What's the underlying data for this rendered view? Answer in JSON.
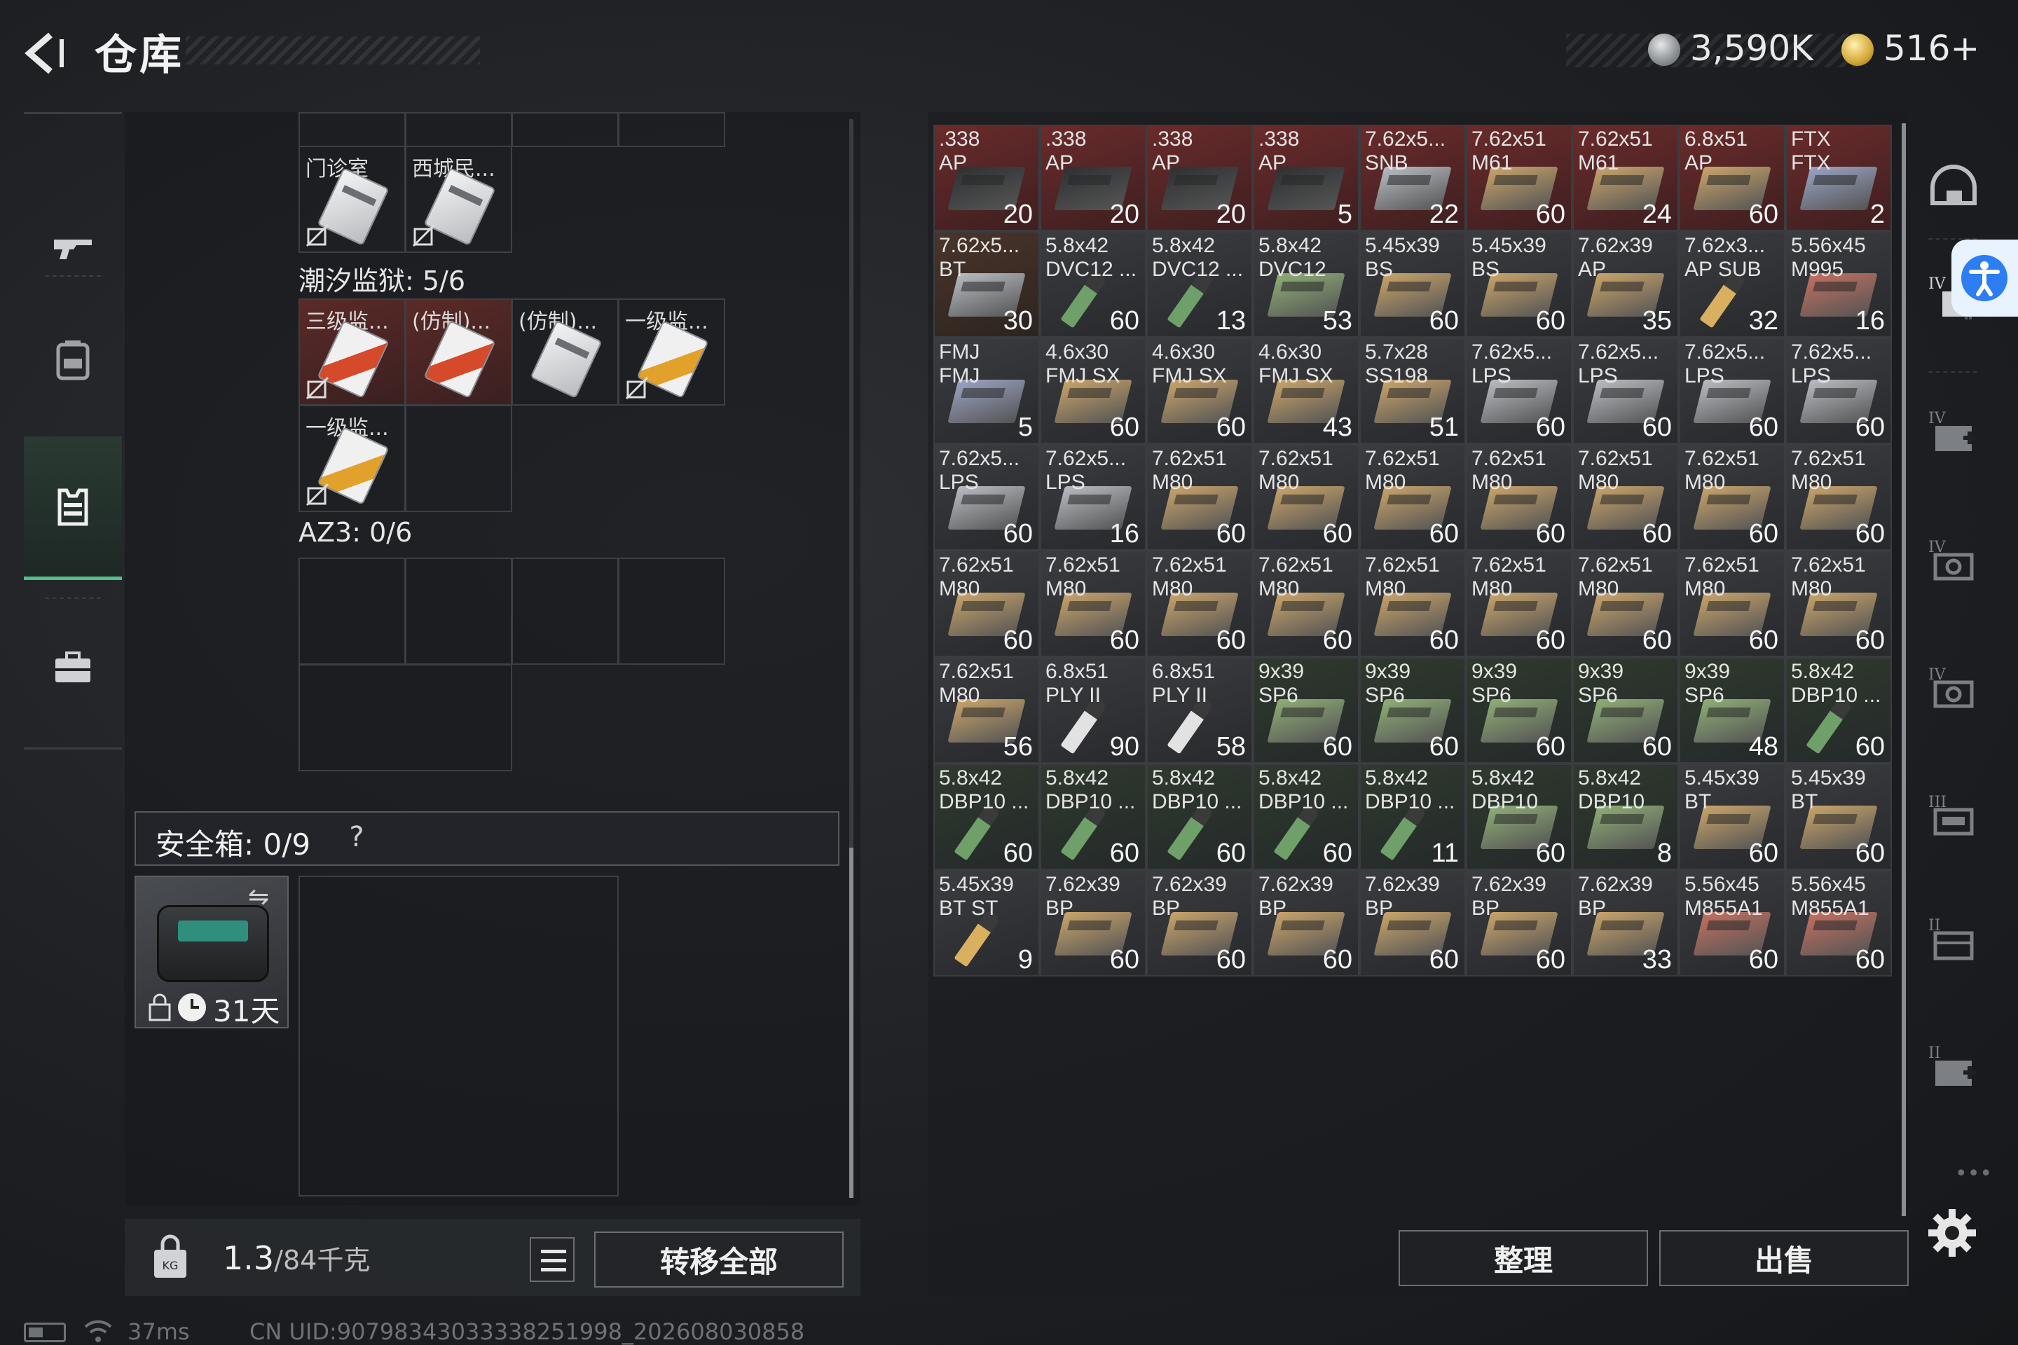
{
  "header": {
    "title": "仓库",
    "currency_silver": "3,590K",
    "currency_gold": "516+"
  },
  "left_nav": {
    "items": [
      "weapon-icon",
      "backpack-icon",
      "vest-icon",
      "case-icon"
    ],
    "active_index": 2
  },
  "containers": {
    "keys_top_row": [
      "门诊室",
      "西城民..."
    ],
    "section1_label": "潮汐监狱: 5/6",
    "section1_items": [
      "三级监...",
      "(仿制)...",
      "(仿制)...",
      "一级监...",
      "一级监..."
    ],
    "section2_label": "AZ3: 0/6"
  },
  "safe_box": {
    "label": "安全箱:  0/9",
    "help": "?",
    "duration": "31天"
  },
  "bottom_left": {
    "weight_main": "1.3",
    "weight_rest": "/84千克",
    "transfer_all": "转移全部"
  },
  "inventory": {
    "colors": {
      "red_slot": "#5c2627",
      "default_slot": "#34363a",
      "green_slot": "#2e3b2c",
      "ammo_box_tan": "#c9a46a",
      "ammo_box_grey": "#b8bcc2",
      "ammo_box_green": "#8fae76"
    },
    "rows": [
      [
        {
          "l1": ".338",
          "l2": "AP",
          "count": "20",
          "bg": "red",
          "icon": "box-dark"
        },
        {
          "l1": ".338",
          "l2": "AP",
          "count": "20",
          "bg": "red",
          "icon": "box-dark"
        },
        {
          "l1": ".338",
          "l2": "AP",
          "count": "20",
          "bg": "red",
          "icon": "box-dark"
        },
        {
          "l1": ".338",
          "l2": "AP",
          "count": "5",
          "bg": "red",
          "icon": "box-dark"
        },
        {
          "l1": "7.62x5...",
          "l2": "SNB",
          "count": "22",
          "bg": "red",
          "icon": "box-grey"
        },
        {
          "l1": "7.62x51",
          "l2": "M61",
          "count": "60",
          "bg": "red",
          "icon": "box-tan"
        },
        {
          "l1": "7.62x51",
          "l2": "M61",
          "count": "24",
          "bg": "red",
          "icon": "box-tan"
        },
        {
          "l1": "6.8x51",
          "l2": "AP",
          "count": "60",
          "bg": "red",
          "icon": "box-tan"
        },
        {
          "l1": "FTX",
          "l2": "FTX",
          "count": "2",
          "bg": "red",
          "icon": "box-blue"
        }
      ],
      [
        {
          "l1": "7.62x5...",
          "l2": "BT",
          "count": "30",
          "bg": "brown",
          "icon": "box-grey"
        },
        {
          "l1": "5.8x42",
          "l2": "DVC12 ...",
          "count": "60",
          "bg": "default",
          "icon": "round-green"
        },
        {
          "l1": "5.8x42",
          "l2": "DVC12 ...",
          "count": "13",
          "bg": "default",
          "icon": "round-green"
        },
        {
          "l1": "5.8x42",
          "l2": "DVC12",
          "count": "53",
          "bg": "default",
          "icon": "box-green"
        },
        {
          "l1": "5.45x39",
          "l2": "BS",
          "count": "60",
          "bg": "default",
          "icon": "box-tan"
        },
        {
          "l1": "5.45x39",
          "l2": "BS",
          "count": "60",
          "bg": "default",
          "icon": "box-tan"
        },
        {
          "l1": "7.62x39",
          "l2": "AP",
          "count": "35",
          "bg": "default",
          "icon": "box-tan"
        },
        {
          "l1": "7.62x3...",
          "l2": "AP SUB",
          "count": "32",
          "bg": "default",
          "icon": "round-brass"
        },
        {
          "l1": "5.56x45",
          "l2": "M995",
          "count": "16",
          "bg": "default",
          "icon": "box-red"
        }
      ],
      [
        {
          "l1": "FMJ",
          "l2": "FMJ",
          "count": "5",
          "bg": "default",
          "icon": "box-blue"
        },
        {
          "l1": "4.6x30",
          "l2": "FMJ SX",
          "count": "60",
          "bg": "default",
          "icon": "box-tan"
        },
        {
          "l1": "4.6x30",
          "l2": "FMJ SX",
          "count": "60",
          "bg": "default",
          "icon": "box-tan"
        },
        {
          "l1": "4.6x30",
          "l2": "FMJ SX",
          "count": "43",
          "bg": "default",
          "icon": "box-tan"
        },
        {
          "l1": "5.7x28",
          "l2": "SS198",
          "count": "51",
          "bg": "default",
          "icon": "box-tan"
        },
        {
          "l1": "7.62x5...",
          "l2": "LPS",
          "count": "60",
          "bg": "default",
          "icon": "box-grey"
        },
        {
          "l1": "7.62x5...",
          "l2": "LPS",
          "count": "60",
          "bg": "default",
          "icon": "box-grey"
        },
        {
          "l1": "7.62x5...",
          "l2": "LPS",
          "count": "60",
          "bg": "default",
          "icon": "box-grey"
        },
        {
          "l1": "7.62x5...",
          "l2": "LPS",
          "count": "60",
          "bg": "default",
          "icon": "box-grey"
        }
      ],
      [
        {
          "l1": "7.62x5...",
          "l2": "LPS",
          "count": "60",
          "bg": "default",
          "icon": "box-grey"
        },
        {
          "l1": "7.62x5...",
          "l2": "LPS",
          "count": "16",
          "bg": "default",
          "icon": "box-grey"
        },
        {
          "l1": "7.62x51",
          "l2": "M80",
          "count": "60",
          "bg": "default",
          "icon": "box-tan"
        },
        {
          "l1": "7.62x51",
          "l2": "M80",
          "count": "60",
          "bg": "default",
          "icon": "box-tan"
        },
        {
          "l1": "7.62x51",
          "l2": "M80",
          "count": "60",
          "bg": "default",
          "icon": "box-tan"
        },
        {
          "l1": "7.62x51",
          "l2": "M80",
          "count": "60",
          "bg": "default",
          "icon": "box-tan"
        },
        {
          "l1": "7.62x51",
          "l2": "M80",
          "count": "60",
          "bg": "default",
          "icon": "box-tan"
        },
        {
          "l1": "7.62x51",
          "l2": "M80",
          "count": "60",
          "bg": "default",
          "icon": "box-tan"
        },
        {
          "l1": "7.62x51",
          "l2": "M80",
          "count": "60",
          "bg": "default",
          "icon": "box-tan"
        }
      ],
      [
        {
          "l1": "7.62x51",
          "l2": "M80",
          "count": "60",
          "bg": "default",
          "icon": "box-tan"
        },
        {
          "l1": "7.62x51",
          "l2": "M80",
          "count": "60",
          "bg": "default",
          "icon": "box-tan"
        },
        {
          "l1": "7.62x51",
          "l2": "M80",
          "count": "60",
          "bg": "default",
          "icon": "box-tan"
        },
        {
          "l1": "7.62x51",
          "l2": "M80",
          "count": "60",
          "bg": "default",
          "icon": "box-tan"
        },
        {
          "l1": "7.62x51",
          "l2": "M80",
          "count": "60",
          "bg": "default",
          "icon": "box-tan"
        },
        {
          "l1": "7.62x51",
          "l2": "M80",
          "count": "60",
          "bg": "default",
          "icon": "box-tan"
        },
        {
          "l1": "7.62x51",
          "l2": "M80",
          "count": "60",
          "bg": "default",
          "icon": "box-tan"
        },
        {
          "l1": "7.62x51",
          "l2": "M80",
          "count": "60",
          "bg": "default",
          "icon": "box-tan"
        },
        {
          "l1": "7.62x51",
          "l2": "M80",
          "count": "60",
          "bg": "default",
          "icon": "box-tan"
        }
      ],
      [
        {
          "l1": "7.62x51",
          "l2": "M80",
          "count": "56",
          "bg": "default",
          "icon": "box-tan"
        },
        {
          "l1": "6.8x51",
          "l2": "PLY II",
          "count": "90",
          "bg": "default",
          "icon": "round-silver"
        },
        {
          "l1": "6.8x51",
          "l2": "PLY II",
          "count": "58",
          "bg": "default",
          "icon": "round-silver"
        },
        {
          "l1": "9x39",
          "l2": "SP6",
          "count": "60",
          "bg": "green",
          "icon": "box-green"
        },
        {
          "l1": "9x39",
          "l2": "SP6",
          "count": "60",
          "bg": "green",
          "icon": "box-green"
        },
        {
          "l1": "9x39",
          "l2": "SP6",
          "count": "60",
          "bg": "green",
          "icon": "box-green"
        },
        {
          "l1": "9x39",
          "l2": "SP6",
          "count": "60",
          "bg": "green",
          "icon": "box-green"
        },
        {
          "l1": "9x39",
          "l2": "SP6",
          "count": "48",
          "bg": "green",
          "icon": "box-green"
        },
        {
          "l1": "5.8x42",
          "l2": "DBP10 ...",
          "count": "60",
          "bg": "green",
          "icon": "round-green"
        }
      ],
      [
        {
          "l1": "5.8x42",
          "l2": "DBP10 ...",
          "count": "60",
          "bg": "green",
          "icon": "round-green"
        },
        {
          "l1": "5.8x42",
          "l2": "DBP10 ...",
          "count": "60",
          "bg": "green",
          "icon": "round-green"
        },
        {
          "l1": "5.8x42",
          "l2": "DBP10 ...",
          "count": "60",
          "bg": "green",
          "icon": "round-green"
        },
        {
          "l1": "5.8x42",
          "l2": "DBP10 ...",
          "count": "60",
          "bg": "green",
          "icon": "round-green"
        },
        {
          "l1": "5.8x42",
          "l2": "DBP10 ...",
          "count": "11",
          "bg": "green",
          "icon": "round-green"
        },
        {
          "l1": "5.8x42",
          "l2": "DBP10",
          "count": "60",
          "bg": "green",
          "icon": "box-green"
        },
        {
          "l1": "5.8x42",
          "l2": "DBP10",
          "count": "8",
          "bg": "green",
          "icon": "box-green"
        },
        {
          "l1": "5.45x39",
          "l2": "BT",
          "count": "60",
          "bg": "default",
          "icon": "box-tan"
        },
        {
          "l1": "5.45x39",
          "l2": "BT",
          "count": "60",
          "bg": "default",
          "icon": "box-tan"
        }
      ],
      [
        {
          "l1": "5.45x39",
          "l2": "BT ST",
          "count": "9",
          "bg": "default",
          "icon": "round-brass"
        },
        {
          "l1": "7.62x39",
          "l2": "BP",
          "count": "60",
          "bg": "default",
          "icon": "box-tan"
        },
        {
          "l1": "7.62x39",
          "l2": "BP",
          "count": "60",
          "bg": "default",
          "icon": "box-tan"
        },
        {
          "l1": "7.62x39",
          "l2": "BP",
          "count": "60",
          "bg": "default",
          "icon": "box-tan"
        },
        {
          "l1": "7.62x39",
          "l2": "BP",
          "count": "60",
          "bg": "default",
          "icon": "box-tan"
        },
        {
          "l1": "7.62x39",
          "l2": "BP",
          "count": "60",
          "bg": "default",
          "icon": "box-tan"
        },
        {
          "l1": "7.62x39",
          "l2": "BP",
          "count": "33",
          "bg": "default",
          "icon": "box-tan"
        },
        {
          "l1": "5.56x45",
          "l2": "M855A1",
          "count": "60",
          "bg": "default",
          "icon": "box-red"
        },
        {
          "l1": "5.56x45",
          "l2": "M855A1",
          "count": "60",
          "bg": "default",
          "icon": "box-red"
        }
      ]
    ]
  },
  "actions": {
    "sort": "整理",
    "sell": "出售"
  },
  "side_tabs": {
    "items": [
      "helmet-tab-icon",
      "armor-tab-icon",
      "medkit-tab-icon",
      "ammo-tab-icon",
      "ammo-tab-icon-2",
      "weapon-tab-icon",
      "box-tab-icon",
      "medkit-tab-icon-2"
    ]
  },
  "status": {
    "ping": "37ms",
    "uid": "CN UID:90798343033338251998_202608030858"
  }
}
